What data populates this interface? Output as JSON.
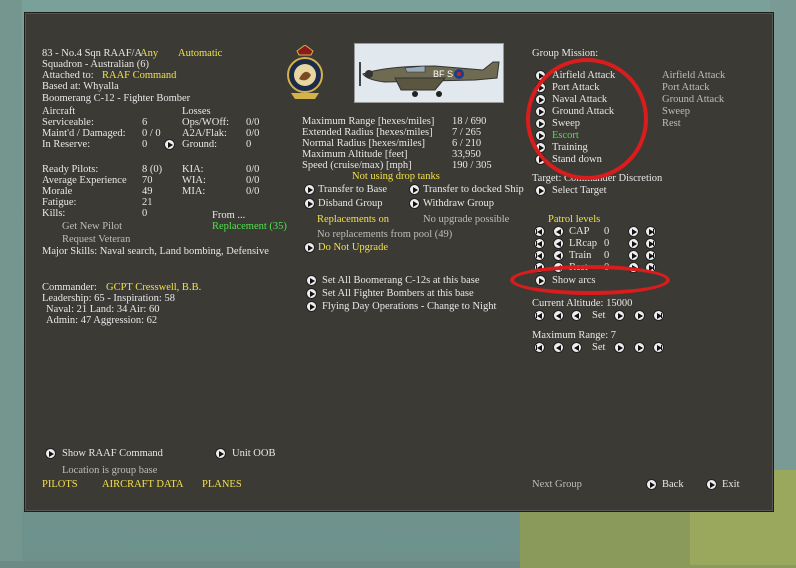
{
  "unit": {
    "line1_prefix": "83 - No.4 Sqn RAAF/A",
    "line1_any": "Any",
    "line1_auto": "Automatic",
    "line2": "Squadron - Australian (6)",
    "attached_label": "Attached to:",
    "attached_value": "RAAF Command",
    "based_at": "Based at: Whyalla",
    "aircraft_type": "Boomerang C-12 - Fighter Bomber"
  },
  "aircraft": {
    "header": "Aircraft",
    "rows": [
      {
        "label": "Serviceable:",
        "value": "6"
      },
      {
        "label": "Maint'd / Damaged:",
        "value": "0 / 0"
      },
      {
        "label": "In Reserve:",
        "value": "0"
      }
    ]
  },
  "losses": {
    "header": "Losses",
    "rows": [
      {
        "label": "Ops/WOff:",
        "value": "0/0"
      },
      {
        "label": "A2A/Flak:",
        "value": "0/0"
      },
      {
        "label": "Ground:",
        "value": "0"
      }
    ]
  },
  "pilots": {
    "rows": [
      {
        "label": "Ready Pilots:",
        "value": "8 (0)"
      },
      {
        "label": "Average Experience",
        "value": "70"
      },
      {
        "label": "Morale",
        "value": "49"
      },
      {
        "label": "Fatigue:",
        "value": "21"
      },
      {
        "label": "Kills:",
        "value": "0"
      }
    ],
    "cas": [
      {
        "label": "KIA:",
        "value": "0/0"
      },
      {
        "label": "WIA:",
        "value": "0/0"
      },
      {
        "label": "MIA:",
        "value": "0/0"
      }
    ],
    "get_new_pilot": "Get New Pilot",
    "request_veteran": "Request Veteran",
    "from": "From ...",
    "replacement": "Replacement (35)",
    "major_skills": "Major Skills:  Naval search, Land bombing, Defensive"
  },
  "stats": [
    {
      "label": "Maximum Range [hexes/miles]",
      "value": "18 / 690"
    },
    {
      "label": "Extended Radius [hexes/miles]",
      "value": "7 / 265"
    },
    {
      "label": "Normal Radius [hexes/miles]",
      "value": "6 / 210"
    },
    {
      "label": "Maximum Altitude [feet]",
      "value": "33,950"
    },
    {
      "label": "Speed (cruise/max) [mph]",
      "value": "190 / 305"
    }
  ],
  "drop_tanks": "Not using drop tanks",
  "actions": {
    "transfer_base": "Transfer to Base",
    "transfer_ship": "Transfer to docked Ship",
    "disband": "Disband Group",
    "withdraw": "Withdraw Group",
    "replacements_on": "Replacements on",
    "no_upgrade": "No upgrade possible",
    "no_replacements": "No replacements from pool (49)",
    "do_not_upgrade": "Do Not Upgrade",
    "set_all_type": "Set All Boomerang C-12s at this base",
    "set_all_fb": "Set All Fighter Bombers at this base",
    "flying_day": "Flying Day Operations - Change to Night"
  },
  "commander": {
    "label": "Commander:",
    "name": "GCPT Cresswell, B.B.",
    "leadership": "Leadership: 65 - Inspiration: 58",
    "naval": "Naval: 21  Land: 34  Air: 60",
    "admin": "Admin: 47  Aggression: 62"
  },
  "mission": {
    "header": "Group Mission:",
    "items": [
      "Airfield Attack",
      "Port Attack",
      "Naval Attack",
      "Ground Attack",
      "Sweep",
      "Escort",
      "Training",
      "Stand down"
    ],
    "right": [
      "Airfield Attack",
      "Port Attack",
      "Ground Attack",
      "Sweep",
      "Rest"
    ],
    "target": "Target: Commander Discretion",
    "select_target": "Select Target"
  },
  "patrol": {
    "header": "Patrol levels",
    "rows": [
      {
        "label": "CAP",
        "value": "0"
      },
      {
        "label": "LRcap",
        "value": "0"
      },
      {
        "label": "Train",
        "value": "0"
      },
      {
        "label": "Rest",
        "value": "0"
      }
    ],
    "show_arcs": "Show arcs",
    "altitude": "Current Altitude: 15000",
    "set": "Set",
    "max_range": "Maximum Range: 7"
  },
  "footer": {
    "show_command": "Show RAAF Command",
    "unit_oob": "Unit OOB",
    "location": "Location is group base",
    "pilots": "PILOTS",
    "aircraft_data": "AIRCRAFT DATA",
    "planes": "PLANES",
    "next_group": "Next Group",
    "back": "Back",
    "exit": "Exit"
  },
  "plane_code": "BF S",
  "colors": {
    "accent_yellow": "#f2e04a",
    "accent_green": "#4ee24e",
    "highlight_red": "#d91c1c",
    "panel": "#3c3a35"
  },
  "icons": [
    "arrow-button-icon",
    "squadron-crest-icon",
    "aircraft-profile-icon"
  ]
}
